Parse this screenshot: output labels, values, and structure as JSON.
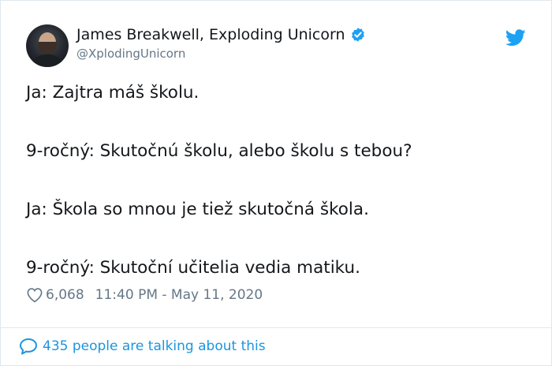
{
  "author": {
    "name": "James Breakwell, Exploding Unicorn",
    "handle": "@XplodingUnicorn",
    "avatar_icon": "avatar-photo"
  },
  "tweet": {
    "lines": [
      "Ja: Zajtra máš školu.",
      "9-ročný: Skutočnú školu, alebo školu s tebou?",
      "Ja: Škola so mnou je tiež skutočná škola.",
      "9-ročný: Skutoční učitelia vedia matiku."
    ]
  },
  "meta": {
    "likes": "6,068",
    "timestamp": "11:40 PM - May 11, 2020"
  },
  "footer": {
    "conversation": "435 people are talking about this"
  },
  "colors": {
    "brand_blue": "#1da1f2",
    "link_blue": "#1b95e0",
    "secondary_text": "#657786",
    "border": "#e1e8ed"
  },
  "icons": [
    "verified-badge-icon",
    "twitter-bird-icon",
    "heart-icon",
    "speech-bubble-icon"
  ]
}
